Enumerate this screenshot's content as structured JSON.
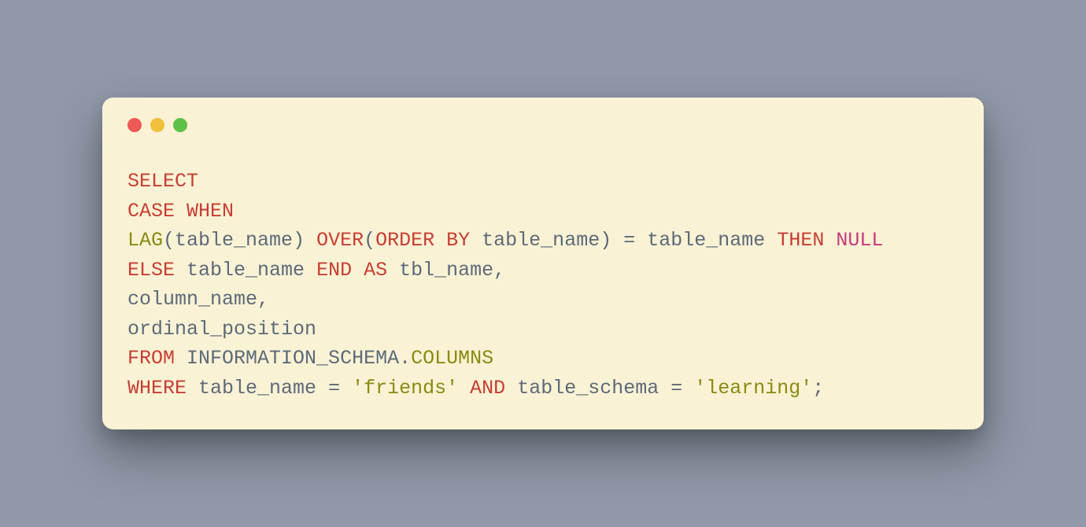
{
  "colors": {
    "background": "#8f99a8",
    "window": "#faf2d5",
    "dot_red": "#ec5a54",
    "dot_yellow": "#f2bf3c",
    "dot_green": "#5dc147",
    "kw_red": "#c73e33",
    "kw_olive": "#8a8b10",
    "kw_pink": "#c63a7d",
    "ident": "#5c6a79"
  },
  "code": {
    "l1": {
      "select": "SELECT"
    },
    "l2": {
      "case": "CASE",
      "when": "WHEN"
    },
    "l3": {
      "lag": "LAG",
      "open1": "(",
      "tn1": "table_name",
      "close1": ")",
      "sp1": " ",
      "over": "OVER",
      "open2": "(",
      "orderby": "ORDER BY",
      "sp2": " ",
      "tn2": "table_name",
      "close2": ")",
      "sp3": " ",
      "eq": "=",
      "sp4": " ",
      "tn3": "table_name",
      "sp5": " ",
      "then": "THEN",
      "sp6": " ",
      "null": "NULL"
    },
    "l4": {
      "else": "ELSE",
      "sp1": " ",
      "tn": "table_name",
      "sp2": " ",
      "end": "END",
      "sp3": " ",
      "as": "AS",
      "sp4": " ",
      "alias": "tbl_name",
      "comma": ","
    },
    "l5": {
      "col": "column_name",
      "comma": ","
    },
    "l6": {
      "col": "ordinal_position"
    },
    "l7": {
      "from": "FROM",
      "sp1": " ",
      "schema": "INFORMATION_SCHEMA",
      "dot": ".",
      "tbl": "COLUMNS"
    },
    "l8": {
      "where": "WHERE",
      "sp1": " ",
      "tn": "table_name",
      "sp2": " ",
      "eq1": "=",
      "sp3": " ",
      "s1": "'friends'",
      "sp4": " ",
      "and": "AND",
      "sp5": " ",
      "ts": "table_schema",
      "sp6": " ",
      "eq2": "=",
      "sp7": " ",
      "s2": "'learning'",
      "semi": ";"
    }
  }
}
